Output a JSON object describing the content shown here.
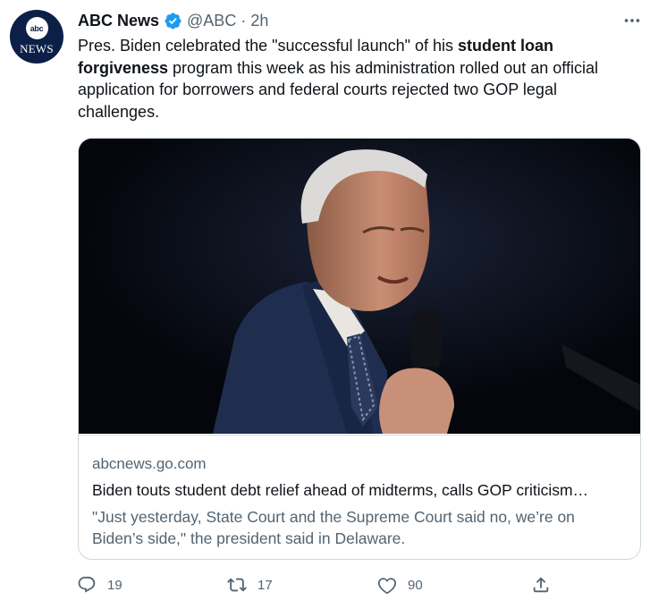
{
  "tweet": {
    "display_name": "ABC News",
    "handle": "@ABC",
    "separator": "·",
    "time": "2h",
    "text": {
      "part1": "Pres. Biden celebrated the \"successful launch\" of his ",
      "bold": "student loan forgiveness",
      "part2": " program this week as his administration rolled out an official application for borrowers and federal courts rejected two GOP legal challenges."
    }
  },
  "avatar": {
    "logo_text": "abc",
    "word": "NEWS"
  },
  "card": {
    "domain": "abcnews.go.com",
    "title": "Biden touts student debt relief ahead of midterms, calls GOP criticism…",
    "description": "\"Just yesterday, State Court and the Supreme Court said no, we’re on Biden’s side,\" the president said in Delaware."
  },
  "actions": {
    "reply_count": "19",
    "retweet_count": "17",
    "like_count": "90"
  },
  "icons": [
    "verified-icon",
    "more-icon",
    "reply-icon",
    "retweet-icon",
    "like-icon",
    "share-icon"
  ],
  "colors": {
    "verified": "#1d9bf0",
    "secondary_text": "#536471",
    "avatar_bg": "#0b1f47"
  }
}
